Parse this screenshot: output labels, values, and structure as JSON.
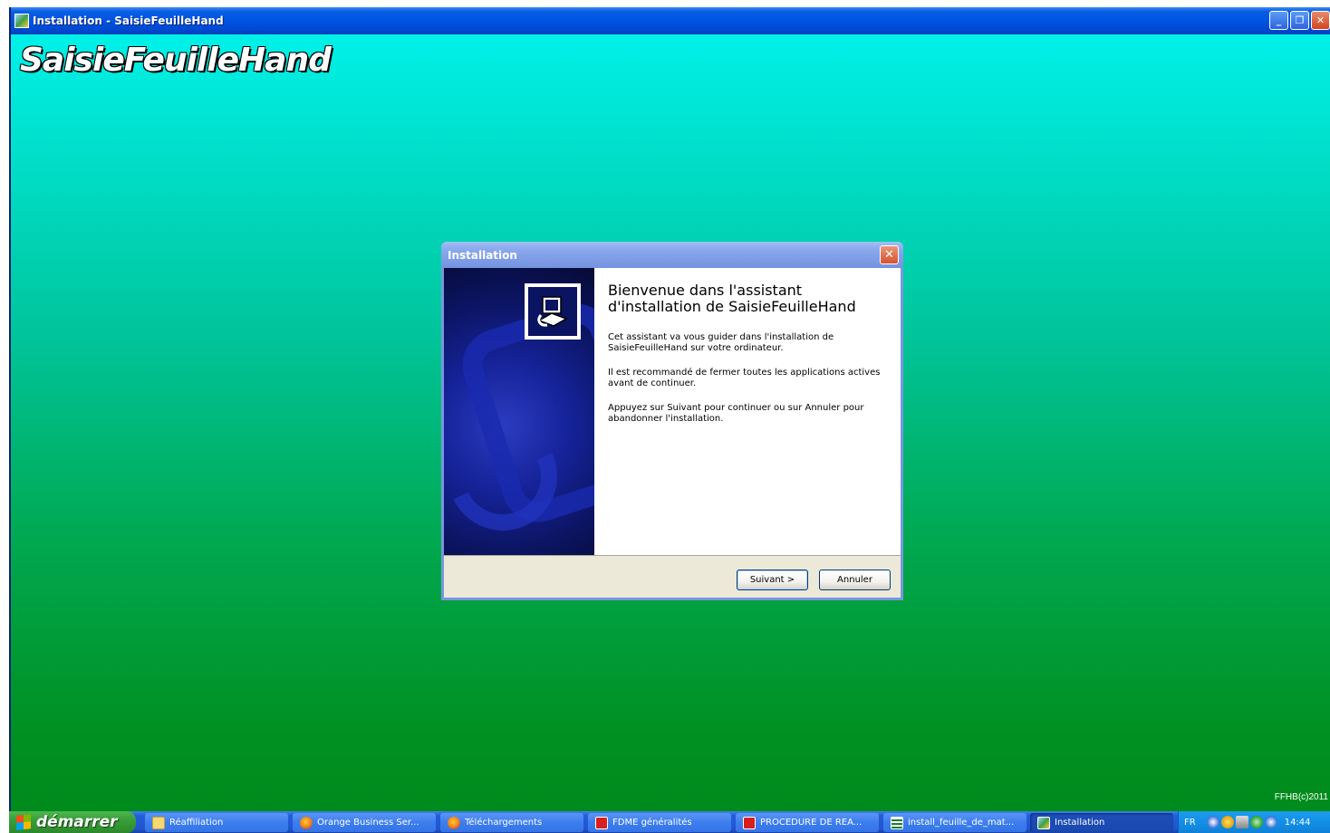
{
  "window": {
    "title": "Installation - SaisieFeuilleHand",
    "banner": "SaisieFeuilleHand",
    "copyright": "FFHB(c)2011",
    "controls": {
      "minimize": "_",
      "maximize": "❐",
      "close": "✕"
    }
  },
  "dialog": {
    "title": "Installation",
    "close": "✕",
    "heading_line1": "Bienvenue dans l'assistant",
    "heading_line2": "d'installation de SaisieFeuilleHand",
    "para1_line1": "Cet assistant va vous guider dans l'installation de",
    "para1_line2": "SaisieFeuilleHand sur votre ordinateur.",
    "para2_line1": "Il est recommandé de fermer toutes les applications actives",
    "para2_line2": "avant de continuer.",
    "para3_line1": "Appuyez sur Suivant pour continuer ou sur Annuler pour",
    "para3_line2": "abandonner l'installation.",
    "next_button": "Suivant >",
    "cancel_button": "Annuler"
  },
  "taskbar": {
    "start_label": "démarrer",
    "tasks": [
      {
        "label": "Réaffiliation",
        "icon": "folder-icon"
      },
      {
        "label": "Orange Business Ser...",
        "icon": "firefox-icon"
      },
      {
        "label": "Téléchargements",
        "icon": "firefox-icon"
      },
      {
        "label": "FDME généralités",
        "icon": "acrobat-icon"
      },
      {
        "label": "PROCEDURE DE REA...",
        "icon": "acrobat-icon"
      },
      {
        "label": "install_feuille_de_mat...",
        "icon": "document-icon"
      },
      {
        "label": "Installation",
        "icon": "installer-icon",
        "active": true
      }
    ],
    "tray": {
      "language": "FR",
      "clock": "14:44"
    }
  }
}
